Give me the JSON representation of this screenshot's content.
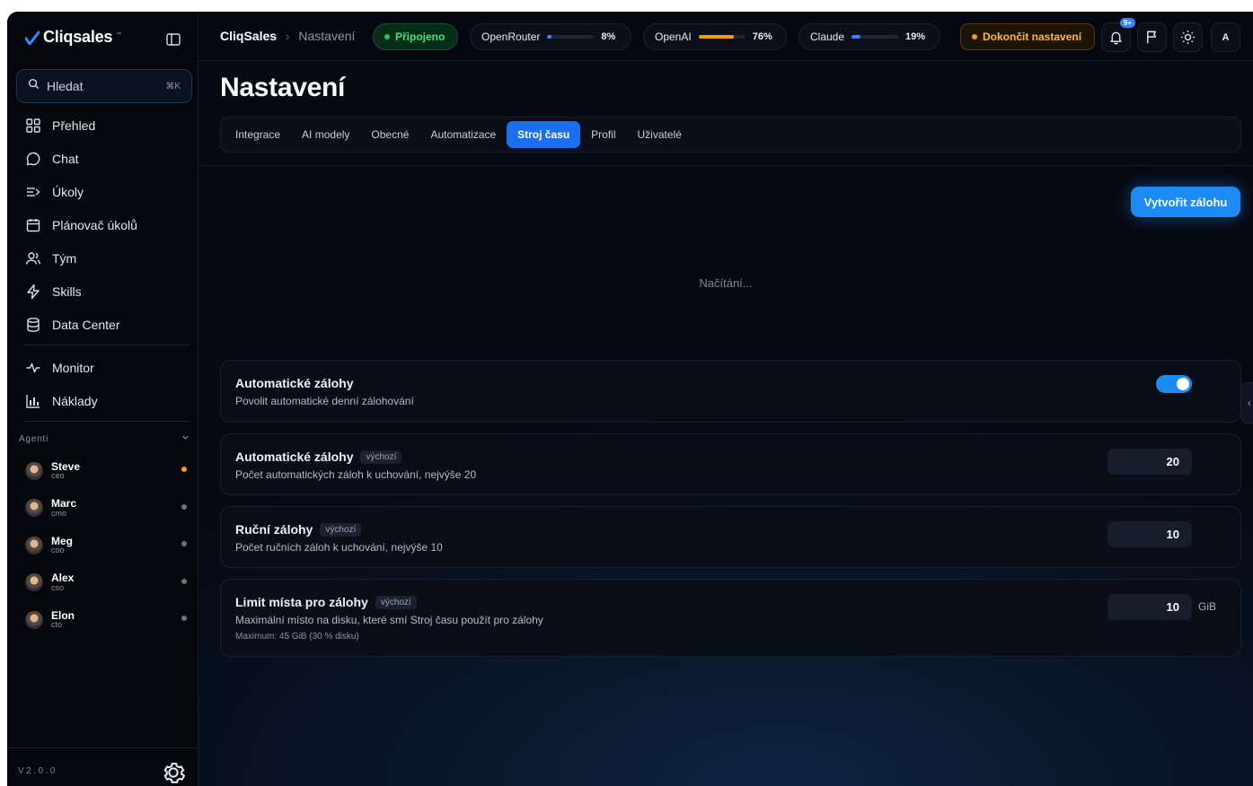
{
  "sidebar": {
    "brand": "Cliqsales",
    "brand_tm": "™",
    "search_placeholder": "Hledat",
    "search_shortcut": "⌘K",
    "nav": [
      {
        "label": "Přehled",
        "icon": "grid-icon"
      },
      {
        "label": "Chat",
        "icon": "chat-bubble-icon"
      },
      {
        "label": "Úkoly",
        "icon": "tasks-icon"
      },
      {
        "label": "Plánovač úkolů",
        "icon": "calendar-icon"
      },
      {
        "label": "Tým",
        "icon": "users-icon"
      },
      {
        "label": "Skills",
        "icon": "lightning-icon"
      },
      {
        "label": "Data Center",
        "icon": "database-icon"
      }
    ],
    "nav2": [
      {
        "label": "Monitor",
        "icon": "pulse-icon"
      },
      {
        "label": "Náklady",
        "icon": "bar-chart-icon"
      }
    ],
    "agents_label": "Agenti",
    "agents": [
      {
        "name": "Steve",
        "role": "ceo",
        "status": "active"
      },
      {
        "name": "Marc",
        "role": "cmo",
        "status": "idle"
      },
      {
        "name": "Meg",
        "role": "coo",
        "status": "idle"
      },
      {
        "name": "Alex",
        "role": "cso",
        "status": "idle"
      },
      {
        "name": "Elon",
        "role": "cto",
        "status": "idle"
      }
    ],
    "version": "V2.0.0"
  },
  "topbar": {
    "app": "CliqSales",
    "separator": "›",
    "page": "Nastavení",
    "status": "Připojeno",
    "providers": [
      {
        "name": "OpenRouter",
        "pct_label": "8%",
        "usage": 0.08,
        "color": "#3b82f6"
      },
      {
        "name": "OpenAI",
        "pct_label": "76%",
        "usage": 0.76,
        "color": "#f59e0b"
      },
      {
        "name": "Claude",
        "pct_label": "19%",
        "usage": 0.19,
        "color": "#3b82f6"
      }
    ],
    "setup_label": "Dokončit nastavení",
    "notifications_badge": "9+",
    "user_initial": "A"
  },
  "page": {
    "title": "Nastavení",
    "tabs": [
      "Integrace",
      "AI modely",
      "Obecné",
      "Automatizace",
      "Stroj času",
      "Profil",
      "Uživatelé"
    ],
    "active_tab": "Stroj času",
    "create_backup": "Vytvořit zálohu",
    "loading": "Načítání..."
  },
  "settings": {
    "auto_backup": {
      "title": "Automatické zálohy",
      "desc": "Povolit automatické denní zálohování",
      "enabled": true
    },
    "auto_count": {
      "title": "Automatické zálohy",
      "tag": "výchozí",
      "desc": "Počet automatických záloh k uchování, nejvýše 20",
      "value": "20"
    },
    "manual_count": {
      "title": "Ruční zálohy",
      "tag": "výchozí",
      "desc": "Počet ručních záloh k uchování, nejvýše 10",
      "value": "10"
    },
    "space_limit": {
      "title": "Limit místa pro zálohy",
      "tag": "výchozí",
      "desc": "Maximální místo na disku, které smí Stroj času použít pro zálohy",
      "note": "Maximum: 45 GiB (30 % disku)",
      "value": "10",
      "unit": "GiB"
    }
  },
  "colors": {
    "accent": "#1d8bf5",
    "active_tab": "#1d6ff2",
    "connected": "#22c55e",
    "warning": "#f59e0b"
  }
}
